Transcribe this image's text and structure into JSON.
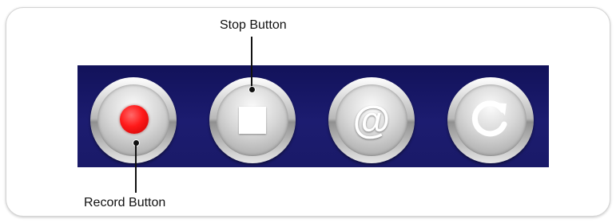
{
  "callouts": {
    "stop_label": "Stop Button",
    "record_label": "Record Button"
  },
  "buttons": [
    {
      "id": "record",
      "icon": "record-dot-icon",
      "color": "#ff1a1a"
    },
    {
      "id": "stop",
      "icon": "stop-square-icon",
      "color": "#ffffff"
    },
    {
      "id": "email",
      "icon": "at-sign-icon",
      "glyph": "@"
    },
    {
      "id": "reload",
      "icon": "reload-icon"
    }
  ],
  "colors": {
    "panel_background": "#1a1a68",
    "button_silver": "#c8c8c8",
    "callout_line": "#111111"
  }
}
